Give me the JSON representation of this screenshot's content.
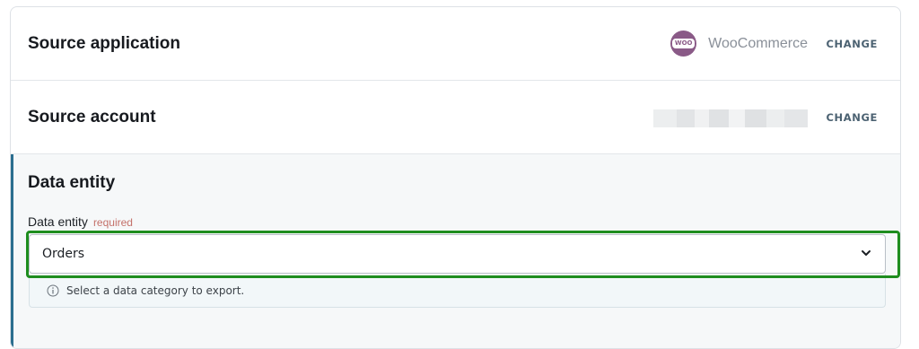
{
  "source_application": {
    "title": "Source application",
    "app_name": "WooCommerce",
    "app_icon": "woocommerce-logo",
    "app_badge_text": "WOO",
    "change_label": "CHANGE"
  },
  "source_account": {
    "title": "Source account",
    "change_label": "CHANGE"
  },
  "data_entity": {
    "section_title": "Data entity",
    "field_label": "Data entity",
    "required_label": "required",
    "selected_value": "Orders",
    "hint": "Select a data category to export."
  },
  "colors": {
    "accent_bar": "#2b6e8f",
    "focus_highlight": "#1e8d1e",
    "woocommerce_brand": "#8a5a87",
    "required_text": "#c4716a"
  }
}
